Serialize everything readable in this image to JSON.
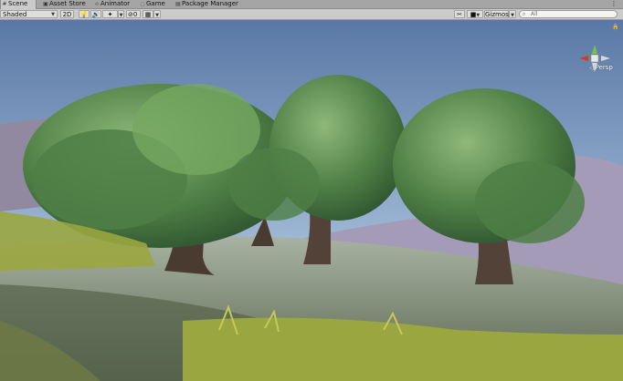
{
  "tabs": [
    {
      "label": "Scene",
      "icon": "scene-icon",
      "active": true
    },
    {
      "label": "Asset Store",
      "icon": "asset-store-icon",
      "active": false
    },
    {
      "label": "Animator",
      "icon": "animator-icon",
      "active": false
    },
    {
      "label": "Game",
      "icon": "game-icon",
      "active": false
    },
    {
      "label": "Package Manager",
      "icon": "package-icon",
      "active": false
    }
  ],
  "toolbar": {
    "draw_mode": "Shaded",
    "mode_2d": "2D",
    "effects_count": "0",
    "gizmos_label": "Gizmos",
    "search_placeholder": "All"
  },
  "scene": {
    "projection_label": "Persp"
  },
  "colors": {
    "sky_top": "#5a78a6",
    "sky_bottom": "#9cb6d3",
    "ground": "#7c8a78",
    "foliage": "#5d8f4f",
    "grass": "#9aa640",
    "mountain": "#a39bb8",
    "gizmo_x": "#d23a2c",
    "gizmo_y": "#7bc24a",
    "gizmo_z": "#3b74c9"
  }
}
